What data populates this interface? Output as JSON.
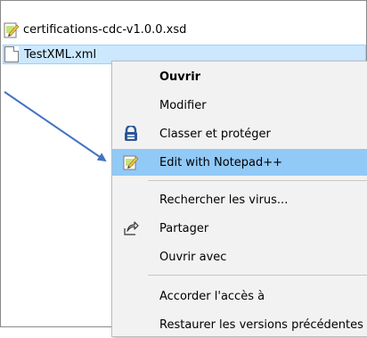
{
  "files": [
    {
      "name": "certifications-cdc-v1.0.0.xsd",
      "icon": "notepadpp-file-icon"
    },
    {
      "name": "TestXML.xml",
      "icon": "blank-file-icon"
    }
  ],
  "context_menu": {
    "items": [
      {
        "label": "Ouvrir",
        "bold": true
      },
      {
        "label": "Modifier"
      },
      {
        "label": "Classer et protéger",
        "icon": "azure-protect-icon"
      },
      {
        "label": "Edit with Notepad++",
        "icon": "notepadpp-icon",
        "highlighted": true
      },
      {
        "label": "Rechercher les virus..."
      },
      {
        "label": "Partager",
        "icon": "share-icon"
      },
      {
        "label": "Ouvrir avec"
      },
      {
        "label": "Accorder l'accès à"
      },
      {
        "label": "Restaurer les versions précédentes"
      }
    ]
  },
  "colors": {
    "selection": "#cce8ff",
    "menu_highlight": "#91c9f7",
    "arrow": "#4472c4",
    "protect_icon": "#2b5797"
  }
}
